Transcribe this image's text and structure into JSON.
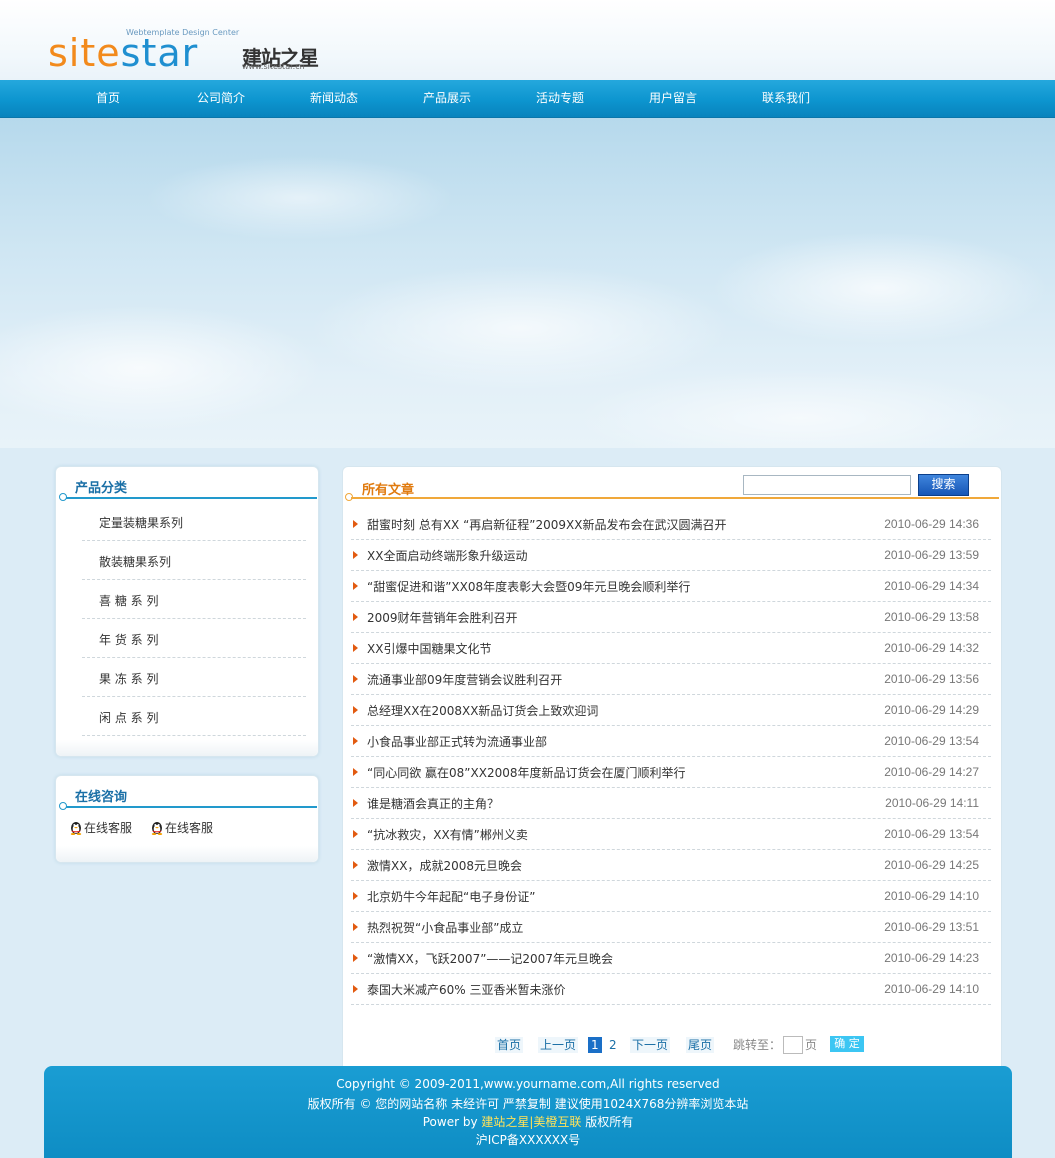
{
  "header": {
    "logo_tagline": "Webtemplate Design Center",
    "logo_site": "site",
    "logo_star": "star",
    "logo_cn": "建站之星",
    "logo_url": "www.sitestar.cn"
  },
  "nav": {
    "items": [
      "首页",
      "公司简介",
      "新闻动态",
      "产品展示",
      "活动专题",
      "用户留言",
      "联系我们"
    ]
  },
  "categories": {
    "title": "产品分类",
    "items": [
      "定量装糖果系列",
      "散装糖果系列",
      "喜 糖 系 列",
      "年 货 系 列",
      "果 冻 系 列",
      "闲 点 系 列"
    ]
  },
  "consult": {
    "title": "在线咨询",
    "items": [
      "在线客服",
      "在线客服"
    ]
  },
  "main": {
    "title": "所有文章",
    "search_placeholder": "",
    "search_label": "搜索",
    "articles": [
      {
        "title": "甜蜜时刻 总有XX “再启新征程”2009XX新品发布会在武汉圆满召开",
        "date": "2010-06-29 14:36"
      },
      {
        "title": "XX全面启动终端形象升级运动",
        "date": "2010-06-29 13:59"
      },
      {
        "title": "“甜蜜促进和谐”XX08年度表彰大会暨09年元旦晚会顺利举行",
        "date": "2010-06-29 14:34"
      },
      {
        "title": "2009财年营销年会胜利召开",
        "date": "2010-06-29 13:58"
      },
      {
        "title": "XX引爆中国糖果文化节",
        "date": "2010-06-29 14:32"
      },
      {
        "title": "流通事业部09年度营销会议胜利召开",
        "date": "2010-06-29 13:56"
      },
      {
        "title": "总经理XX在2008XX新品订货会上致欢迎词",
        "date": "2010-06-29 14:29"
      },
      {
        "title": "小食品事业部正式转为流通事业部",
        "date": "2010-06-29 13:54"
      },
      {
        "title": "“同心同欲 赢在08”XX2008年度新品订货会在厦门顺利举行",
        "date": "2010-06-29 14:27"
      },
      {
        "title": "谁是糖酒会真正的主角？",
        "date": "2010-06-29 14:11"
      },
      {
        "title": "“抗冰救灾，XX有情”郴州义卖",
        "date": "2010-06-29 13:54"
      },
      {
        "title": "激情XX，成就2008元旦晚会",
        "date": "2010-06-29 14:25"
      },
      {
        "title": "北京奶牛今年起配“电子身份证”",
        "date": "2010-06-29 14:10"
      },
      {
        "title": "热烈祝贺“小食品事业部”成立",
        "date": "2010-06-29 13:51"
      },
      {
        "title": "“激情XX，飞跃2007”——记2007年元旦晚会",
        "date": "2010-06-29 14:23"
      },
      {
        "title": "泰国大米减产60% 三亚香米暂未涨价",
        "date": "2010-06-29 14:10"
      }
    ]
  },
  "pager": {
    "first": "首页",
    "prev": "上一页",
    "pages": [
      "1",
      "2"
    ],
    "current": "1",
    "next": "下一页",
    "last": "尾页",
    "jump_label": "跳转至：",
    "page_unit": "页",
    "go": "确 定"
  },
  "footer": {
    "copyright": "Copyright © 2009-2011,www.yourname.com,All rights reserved",
    "notice": "版权所有 © 您的网站名称 未经许可 严禁复制 建议使用1024X768分辨率浏览本站",
    "power_prefix": "Power by ",
    "power_link": "建站之星|美橙互联",
    "power_suffix": " 版权所有",
    "icp": "沪ICP备XXXXXX号"
  },
  "colors": {
    "nav_blue": "#0d95cf",
    "category_title": "#1a6fa6",
    "main_title_orange": "#e07b10",
    "footer_link": "#ffe25a"
  }
}
